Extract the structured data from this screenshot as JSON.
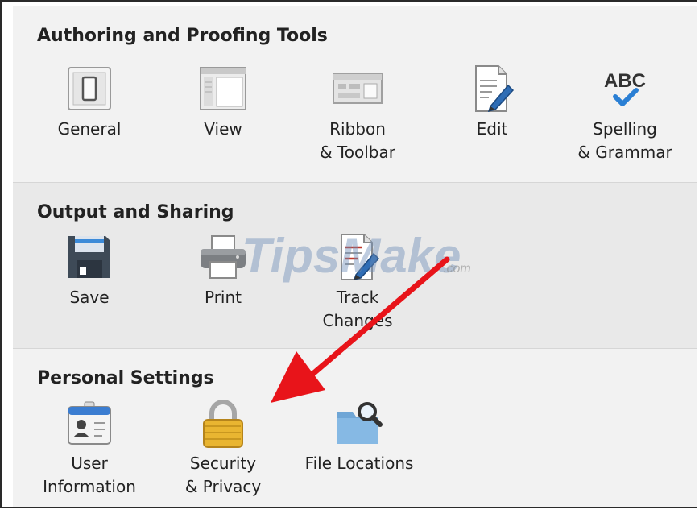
{
  "sections": [
    {
      "title": "Authoring and Proofing Tools",
      "items": [
        {
          "line1": "General",
          "line2": "",
          "icon": "general-switch-icon"
        },
        {
          "line1": "View",
          "line2": "",
          "icon": "view-icon"
        },
        {
          "line1": "Ribbon",
          "line2": "& Toolbar",
          "icon": "ribbon-toolbar-icon"
        },
        {
          "line1": "Edit",
          "line2": "",
          "icon": "edit-document-icon"
        },
        {
          "line1": "Spelling",
          "line2": "& Grammar",
          "icon": "abc-check-icon"
        }
      ]
    },
    {
      "title": "Output and Sharing",
      "items": [
        {
          "line1": "Save",
          "line2": "",
          "icon": "floppy-disk-icon"
        },
        {
          "line1": "Print",
          "line2": "",
          "icon": "printer-icon"
        },
        {
          "line1": "Track",
          "line2": "Changes",
          "icon": "track-changes-icon"
        }
      ]
    },
    {
      "title": "Personal Settings",
      "items": [
        {
          "line1": "User",
          "line2": "Information",
          "icon": "id-badge-icon"
        },
        {
          "line1": "Security",
          "line2": "& Privacy",
          "icon": "padlock-icon"
        },
        {
          "line1": "File Locations",
          "line2": "",
          "icon": "folder-search-icon"
        }
      ]
    }
  ],
  "watermark": {
    "text": "TipsMake",
    "suffix": ".com"
  },
  "colors": {
    "arrow": "#e8141a",
    "check": "#2a7fd4",
    "lock": "#e9b531"
  }
}
